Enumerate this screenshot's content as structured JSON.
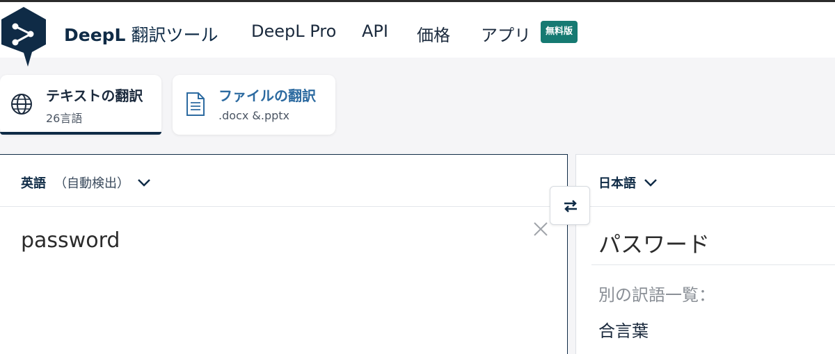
{
  "header": {
    "brand_bold": "DeepL",
    "brand_rest": "翻訳ツール",
    "nav": [
      "DeepL Pro",
      "API",
      "価格",
      "アプリ"
    ],
    "badge": "無料版"
  },
  "tabs": [
    {
      "title": "テキストの翻訳",
      "sub": "26言語",
      "active": true,
      "icon": "globe-icon"
    },
    {
      "title": "ファイルの翻訳",
      "sub": ".docx &.pptx",
      "active": false,
      "icon": "document-icon"
    }
  ],
  "source": {
    "lang": "英語",
    "detect": "（自動検出）",
    "text": "password"
  },
  "target": {
    "lang": "日本語",
    "text": "パスワード",
    "alt_label": "別の訳語一覧：",
    "alt_items": [
      "合言葉"
    ]
  },
  "colors": {
    "brand_navy": "#0f2b46",
    "badge_teal": "#167a72",
    "active_tab_text": "#1b2a3d",
    "inactive_tab_text": "#2c6aa0"
  }
}
